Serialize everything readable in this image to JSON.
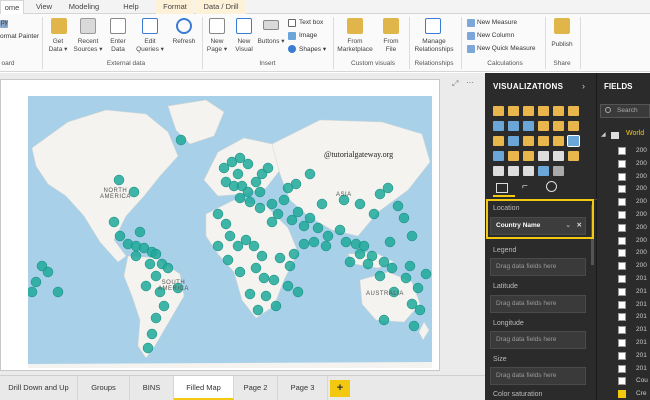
{
  "ribbon": {
    "tabs": [
      "ome",
      "View",
      "Modeling",
      "Help",
      "Format",
      "Data / Drill"
    ],
    "clipboard": {
      "copy": "py",
      "format_painter": "ormat Painter",
      "group": "oard"
    },
    "external_data": {
      "get_data": [
        "Get",
        "Data"
      ],
      "recent_sources": [
        "Recent",
        "Sources"
      ],
      "enter_data": [
        "Enter",
        "Data"
      ],
      "edit_queries": [
        "Edit",
        "Queries"
      ],
      "refresh": "Refresh",
      "group": "External data"
    },
    "insert": {
      "new_page": [
        "New",
        "Page"
      ],
      "new_visual": [
        "New",
        "Visual"
      ],
      "buttons": "Buttons",
      "text_box": "Text box",
      "image": "Image",
      "shapes": "Shapes",
      "group": "Insert"
    },
    "custom_visuals": {
      "from_marketplace": [
        "From",
        "Marketplace"
      ],
      "from_file": [
        "From",
        "File"
      ],
      "group": "Custom visuals"
    },
    "relationships": {
      "manage": [
        "Manage",
        "Relationships"
      ],
      "group": "Relationships"
    },
    "calculations": {
      "new_measure": "New Measure",
      "new_column": "New Column",
      "new_quick_measure": "New Quick Measure",
      "group": "Calculations"
    },
    "share": {
      "publish": "Publish",
      "group": "Share"
    }
  },
  "map": {
    "labels": {
      "north_america": [
        "NORTH",
        "AMERICA"
      ],
      "south_america": [
        "SOUTH",
        "AMERICA"
      ],
      "asia": "ASIA",
      "australia": "AUSTRALIA"
    },
    "watermark": "@tutorialgateway.org"
  },
  "pages": [
    "Drill Down and Up",
    "Groups",
    "BINS",
    "Filled Map",
    "Page 2",
    "Page 3"
  ],
  "add_page": "+",
  "visualizations": {
    "title": "VISUALIZATIONS",
    "location_header": "Location",
    "location_value": "Country Name",
    "wells": [
      {
        "header": "Legend",
        "placeholder": "Drag data fields here"
      },
      {
        "header": "Latitude",
        "placeholder": "Drag data fields here"
      },
      {
        "header": "Longitude",
        "placeholder": "Drag data fields here"
      },
      {
        "header": "Size",
        "placeholder": "Drag data fields here"
      },
      {
        "header": "Color saturation",
        "placeholder": ""
      }
    ]
  },
  "fields": {
    "title": "FIELDS",
    "search_placeholder": "Search",
    "table_name": "World",
    "rows": [
      "200",
      "200",
      "200",
      "200",
      "200",
      "200",
      "200",
      "200",
      "200",
      "200",
      "201",
      "201",
      "201",
      "201",
      "201",
      "201",
      "201",
      "201",
      "Cou",
      "Cre"
    ],
    "checked_row": "Cre"
  },
  "colors": {
    "accent": "#f2c811",
    "bubble": "#1fa99a",
    "water": "#a8d1e9",
    "land": "#f4f3ef"
  }
}
